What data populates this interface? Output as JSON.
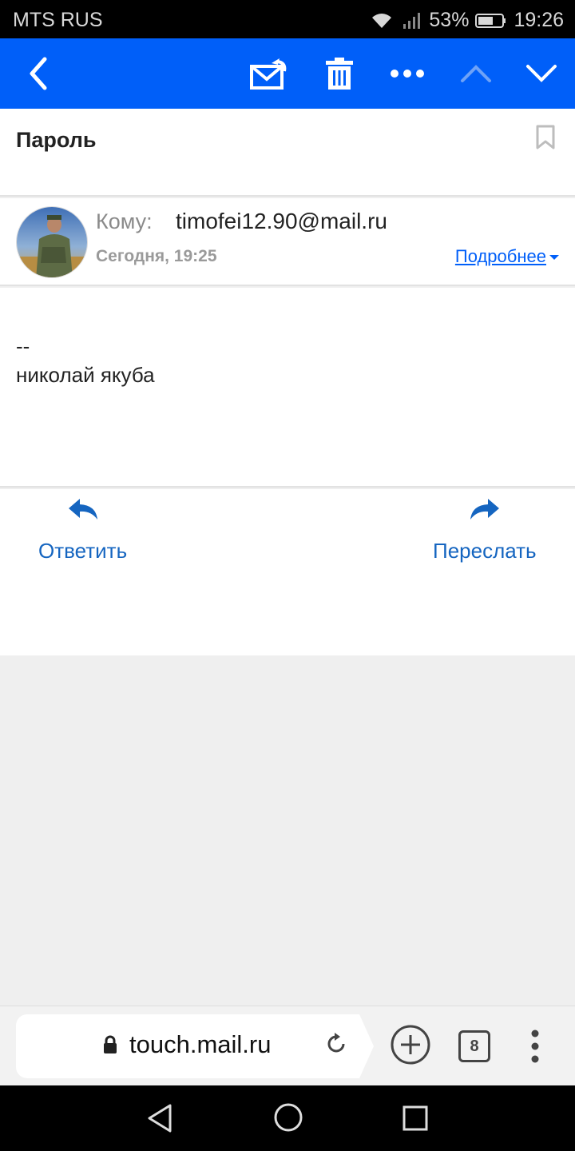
{
  "statusbar": {
    "carrier": "MTS RUS",
    "battery": "53%",
    "time": "19:26"
  },
  "toolbar": {
    "icons": [
      "back-icon",
      "reply-mail-icon",
      "trash-icon",
      "more-icon",
      "chevron-up-icon",
      "chevron-down-icon"
    ]
  },
  "message": {
    "subject": "Пароль",
    "to_label": "Кому:",
    "to_value": "timofei12.90@mail.ru",
    "date": "Сегодня, 19:25",
    "details_label": "Подробнее",
    "body_line1": "--",
    "body_line2": "николай якуба"
  },
  "actions": {
    "reply_label": "Ответить",
    "forward_label": "Переслать"
  },
  "browser": {
    "url": "touch.mail.ru",
    "tab_count": "8"
  },
  "colors": {
    "accent": "#005ff9",
    "link": "#1565c0",
    "background": "#efefef"
  }
}
